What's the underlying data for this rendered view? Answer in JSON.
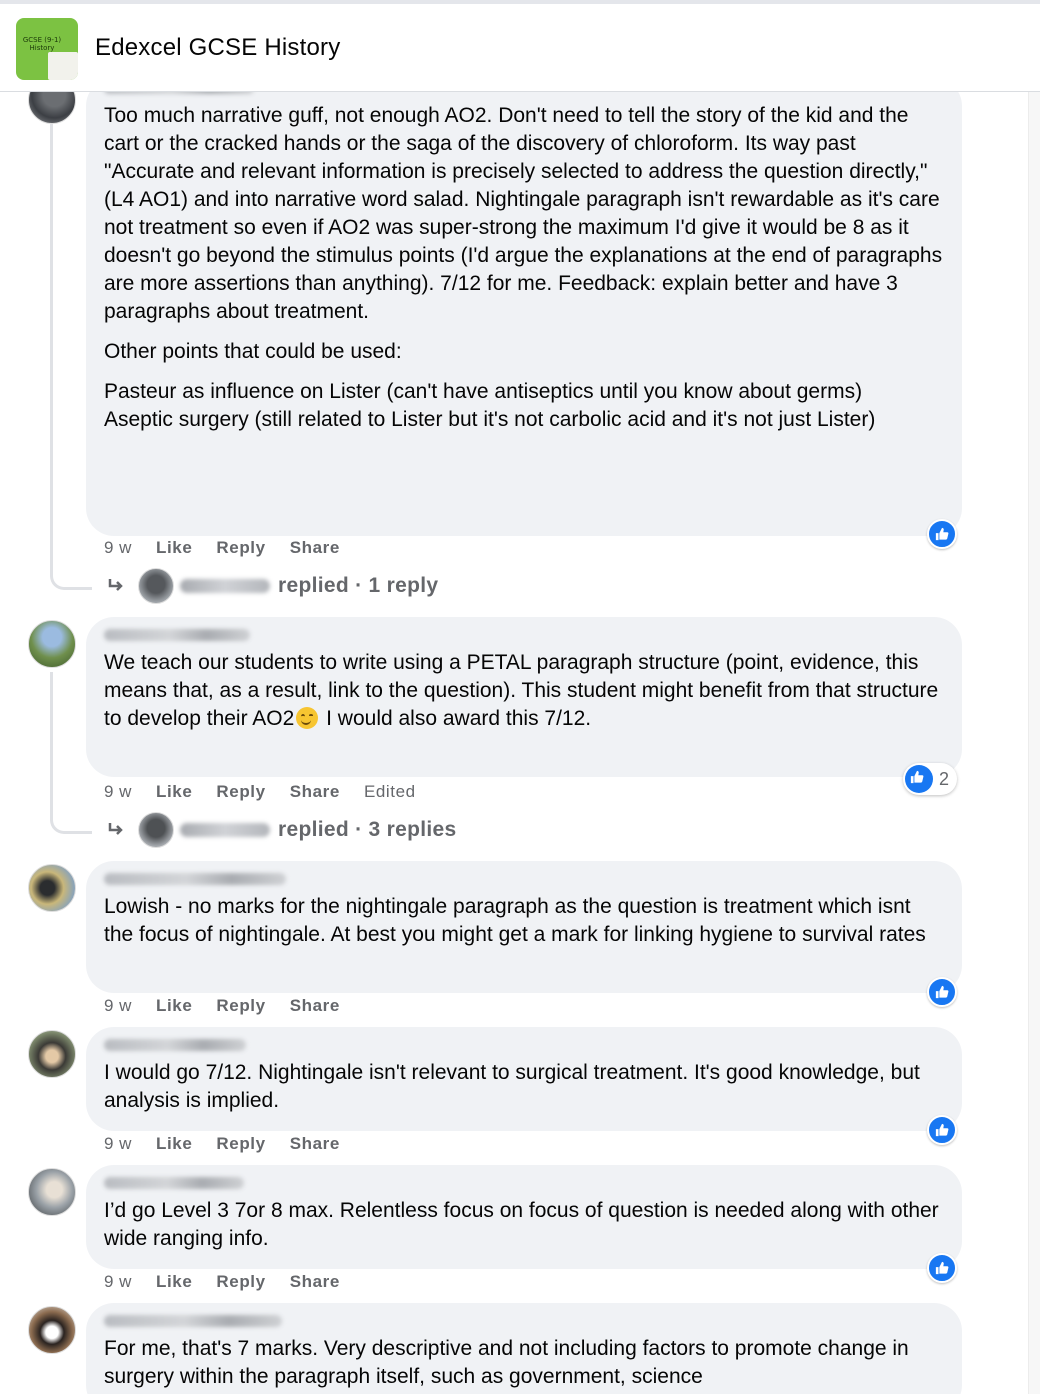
{
  "header": {
    "group_title": "Edexcel GCSE History",
    "thumb_text": "GCSE (9-1) History"
  },
  "icons": {
    "like": "thumbs-up-icon",
    "reply_arrow": "reply-arrow-icon"
  },
  "colors": {
    "like_blue": "#1877f2",
    "bubble_bg": "#f0f2f5",
    "meta_gray": "#65676b"
  },
  "comments": [
    {
      "paragraphs": [
        "Too much narrative guff, not enough AO2. Don't need to tell the story of the kid and the cart or the cracked hands or the saga of the discovery of chloroform. Its way past \"Accurate and relevant information is precisely selected to address the question directly,\" (L4 AO1) and into narrative word salad. Nightingale paragraph isn't rewardable as it's care not treatment so even if AO2 was super-strong the maximum I'd give it would be 8 as it doesn't go beyond the stimulus points (I'd argue the explanations at the end of paragraphs are more assertions than anything). 7/12 for me. Feedback: explain better and have 3 paragraphs about treatment.",
        "Other points that could be used:",
        "Pasteur as influence on Lister (can't have antiseptics until you know about germs)",
        "Aseptic surgery (still related to Lister but it's not carbolic acid and it's not just Lister)"
      ],
      "time": "9 w",
      "like_label": "Like",
      "reply_label": "Reply",
      "share_label": "Share",
      "replied_text": "replied · 1 reply"
    },
    {
      "text_before_emoji": "We teach our students to write using a PETAL paragraph structure (point, evidence, this means that, as a result, link to the question). This student might benefit from that structure to develop their AO2",
      "text_after_emoji": " I would also award this 7/12.",
      "time": "9 w",
      "like_label": "Like",
      "reply_label": "Reply",
      "share_label": "Share",
      "edited_label": "Edited",
      "reaction_count": "2",
      "replied_text": "replied · 3 replies"
    },
    {
      "text": "Lowish - no marks for the nightingale paragraph as the question is treatment which isnt the focus of nightingale. At best you might get a mark for linking hygiene to survival rates",
      "time": "9 w",
      "like_label": "Like",
      "reply_label": "Reply",
      "share_label": "Share"
    },
    {
      "text": "I would go 7/12. Nightingale isn't relevant to surgical treatment. It's good knowledge, but analysis is implied.",
      "time": "9 w",
      "like_label": "Like",
      "reply_label": "Reply",
      "share_label": "Share"
    },
    {
      "text": "I’d go Level 3 7or 8 max. Relentless focus on focus of question is needed along with other wide ranging info.",
      "time": "9 w",
      "like_label": "Like",
      "reply_label": "Reply",
      "share_label": "Share"
    },
    {
      "text": "For me, that's 7 marks. Very descriptive and not including factors to promote change in surgery within the paragraph itself, such as government, science"
    }
  ]
}
